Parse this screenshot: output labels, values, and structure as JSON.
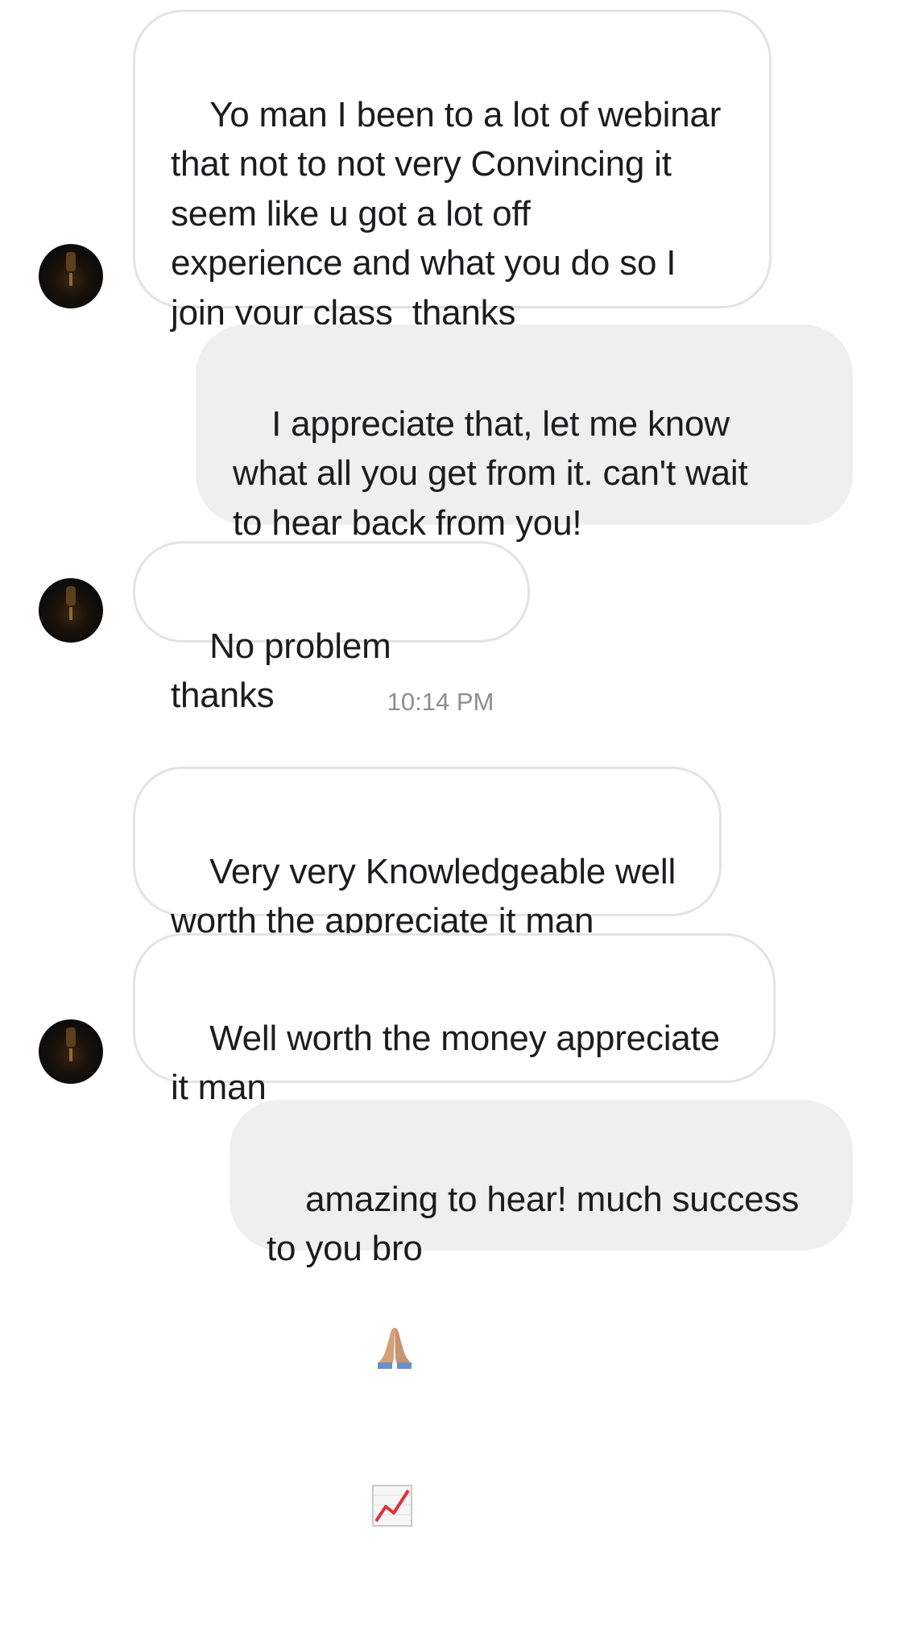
{
  "conversation": {
    "messages": [
      {
        "sender": "them",
        "text": "Yo man I been to a lot of webinar\nthat not to not very Convincing it\nseem like u got a lot off\nexperience and what you do so I\njoin your class  thanks"
      },
      {
        "sender": "me",
        "text": "I appreciate that, let me know\nwhat all you get from it. can't wait\nto hear back from you!"
      },
      {
        "sender": "them",
        "text": "No problem thanks"
      },
      {
        "sender": "them",
        "text": "Very very Knowledgeable well\nworth the appreciate it man"
      },
      {
        "sender": "them",
        "text": "Well worth the money appreciate\nit man"
      },
      {
        "sender": "me",
        "text": "amazing to hear! much success\nto you bro",
        "emojis": [
          "folded-hands-emoji",
          "chart-increasing-emoji"
        ]
      }
    ],
    "timestamp": "10:14 PM"
  },
  "colors": {
    "incoming_bg": "#ffffff",
    "incoming_border": "#e3e3e3",
    "outgoing_bg": "#efefef",
    "text": "#1c1c1e",
    "timestamp": "#8e8e8e"
  }
}
